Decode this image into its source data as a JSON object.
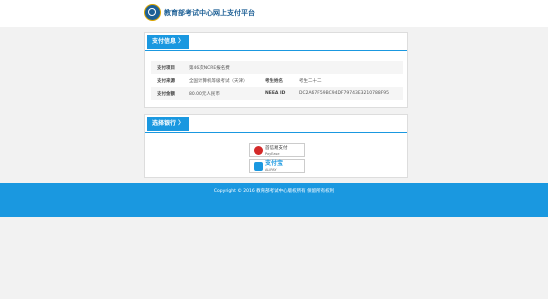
{
  "header": {
    "title": "教育部考试中心网上支付平台"
  },
  "payment_info": {
    "tab_label": "支付信息 〉",
    "rows": [
      {
        "label": "支付项目",
        "value": "第46次NCRE报名费"
      },
      {
        "label": "支付来源",
        "value": "全国计算机等级考试（天津）",
        "label2": "考生姓名",
        "value2": "考生二十二"
      },
      {
        "label": "支付金额",
        "value": "80.00元人民币",
        "label2": "NEEA ID",
        "value2": "DC2A67F59BC94DF79743E3210788F95"
      }
    ]
  },
  "bank_select": {
    "tab_label": "选择银行 〉",
    "banks": [
      {
        "name": "首信易支付",
        "sub": "PayEase"
      },
      {
        "name": "支付宝",
        "sub": "ALIPAY"
      }
    ]
  },
  "footer": {
    "copyright": "Copyright © 2016 教育部考试中心版权所有 保留所有权利"
  },
  "colors": {
    "accent": "#1a98e0",
    "brand": "#1c5f95",
    "background": "#f2f2f2"
  },
  "icons": {
    "logo": "ministry-seal-icon",
    "bank_1": "payease-logo-icon",
    "bank_2": "alipay-logo-icon"
  }
}
